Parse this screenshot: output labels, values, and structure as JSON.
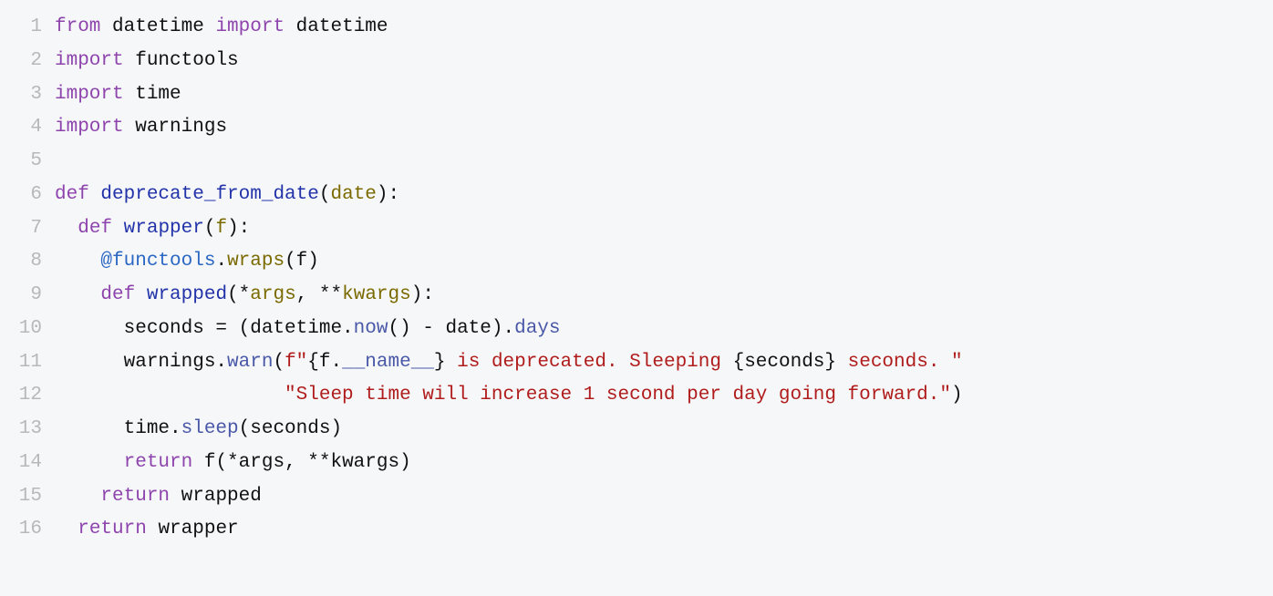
{
  "code": {
    "lines": [
      {
        "num": "1",
        "tokens": [
          {
            "cls": "kw",
            "text": "from"
          },
          {
            "cls": "plain",
            "text": " datetime "
          },
          {
            "cls": "kw",
            "text": "import"
          },
          {
            "cls": "plain",
            "text": " datetime"
          }
        ]
      },
      {
        "num": "2",
        "tokens": [
          {
            "cls": "kw",
            "text": "import"
          },
          {
            "cls": "plain",
            "text": " functools"
          }
        ]
      },
      {
        "num": "3",
        "tokens": [
          {
            "cls": "kw",
            "text": "import"
          },
          {
            "cls": "plain",
            "text": " time"
          }
        ]
      },
      {
        "num": "4",
        "tokens": [
          {
            "cls": "kw",
            "text": "import"
          },
          {
            "cls": "plain",
            "text": " warnings"
          }
        ]
      },
      {
        "num": "5",
        "tokens": [
          {
            "cls": "plain",
            "text": ""
          }
        ]
      },
      {
        "num": "6",
        "tokens": [
          {
            "cls": "kw",
            "text": "def"
          },
          {
            "cls": "plain",
            "text": " "
          },
          {
            "cls": "fname",
            "text": "deprecate_from_date"
          },
          {
            "cls": "plain",
            "text": "("
          },
          {
            "cls": "param",
            "text": "date"
          },
          {
            "cls": "plain",
            "text": "):"
          }
        ]
      },
      {
        "num": "7",
        "tokens": [
          {
            "cls": "plain",
            "text": "  "
          },
          {
            "cls": "kw",
            "text": "def"
          },
          {
            "cls": "plain",
            "text": " "
          },
          {
            "cls": "fname",
            "text": "wrapper"
          },
          {
            "cls": "plain",
            "text": "("
          },
          {
            "cls": "param",
            "text": "f"
          },
          {
            "cls": "plain",
            "text": "):"
          }
        ]
      },
      {
        "num": "8",
        "tokens": [
          {
            "cls": "plain",
            "text": "    "
          },
          {
            "cls": "decorator",
            "text": "@functools"
          },
          {
            "cls": "plain",
            "text": "."
          },
          {
            "cls": "param",
            "text": "wraps"
          },
          {
            "cls": "plain",
            "text": "(f)"
          }
        ]
      },
      {
        "num": "9",
        "tokens": [
          {
            "cls": "plain",
            "text": "    "
          },
          {
            "cls": "kw",
            "text": "def"
          },
          {
            "cls": "plain",
            "text": " "
          },
          {
            "cls": "fname",
            "text": "wrapped"
          },
          {
            "cls": "plain",
            "text": "("
          },
          {
            "cls": "plain",
            "text": "*"
          },
          {
            "cls": "param",
            "text": "args"
          },
          {
            "cls": "plain",
            "text": ", **"
          },
          {
            "cls": "param",
            "text": "kwargs"
          },
          {
            "cls": "plain",
            "text": "):"
          }
        ]
      },
      {
        "num": "10",
        "tokens": [
          {
            "cls": "plain",
            "text": "      seconds = (datetime."
          },
          {
            "cls": "attr",
            "text": "now"
          },
          {
            "cls": "plain",
            "text": "() - date)."
          },
          {
            "cls": "attr",
            "text": "days"
          }
        ]
      },
      {
        "num": "11",
        "tokens": [
          {
            "cls": "plain",
            "text": "      warnings."
          },
          {
            "cls": "attr",
            "text": "warn"
          },
          {
            "cls": "plain",
            "text": "("
          },
          {
            "cls": "str",
            "text": "f\""
          },
          {
            "cls": "plain",
            "text": "{f."
          },
          {
            "cls": "attr",
            "text": "__name__"
          },
          {
            "cls": "plain",
            "text": "}"
          },
          {
            "cls": "str",
            "text": " is deprecated. Sleeping "
          },
          {
            "cls": "plain",
            "text": "{seconds}"
          },
          {
            "cls": "str",
            "text": " seconds. \""
          }
        ]
      },
      {
        "num": "12",
        "tokens": [
          {
            "cls": "plain",
            "text": "                    "
          },
          {
            "cls": "str",
            "text": "\"Sleep time will increase 1 second per day going forward.\""
          },
          {
            "cls": "plain",
            "text": ")"
          }
        ]
      },
      {
        "num": "13",
        "tokens": [
          {
            "cls": "plain",
            "text": "      time."
          },
          {
            "cls": "attr",
            "text": "sleep"
          },
          {
            "cls": "plain",
            "text": "(seconds)"
          }
        ]
      },
      {
        "num": "14",
        "tokens": [
          {
            "cls": "plain",
            "text": "      "
          },
          {
            "cls": "kw",
            "text": "return"
          },
          {
            "cls": "plain",
            "text": " f(*args, **kwargs)"
          }
        ]
      },
      {
        "num": "15",
        "tokens": [
          {
            "cls": "plain",
            "text": "    "
          },
          {
            "cls": "kw",
            "text": "return"
          },
          {
            "cls": "plain",
            "text": " wrapped"
          }
        ]
      },
      {
        "num": "16",
        "tokens": [
          {
            "cls": "plain",
            "text": "  "
          },
          {
            "cls": "kw",
            "text": "return"
          },
          {
            "cls": "plain",
            "text": " wrapper"
          }
        ]
      }
    ]
  }
}
